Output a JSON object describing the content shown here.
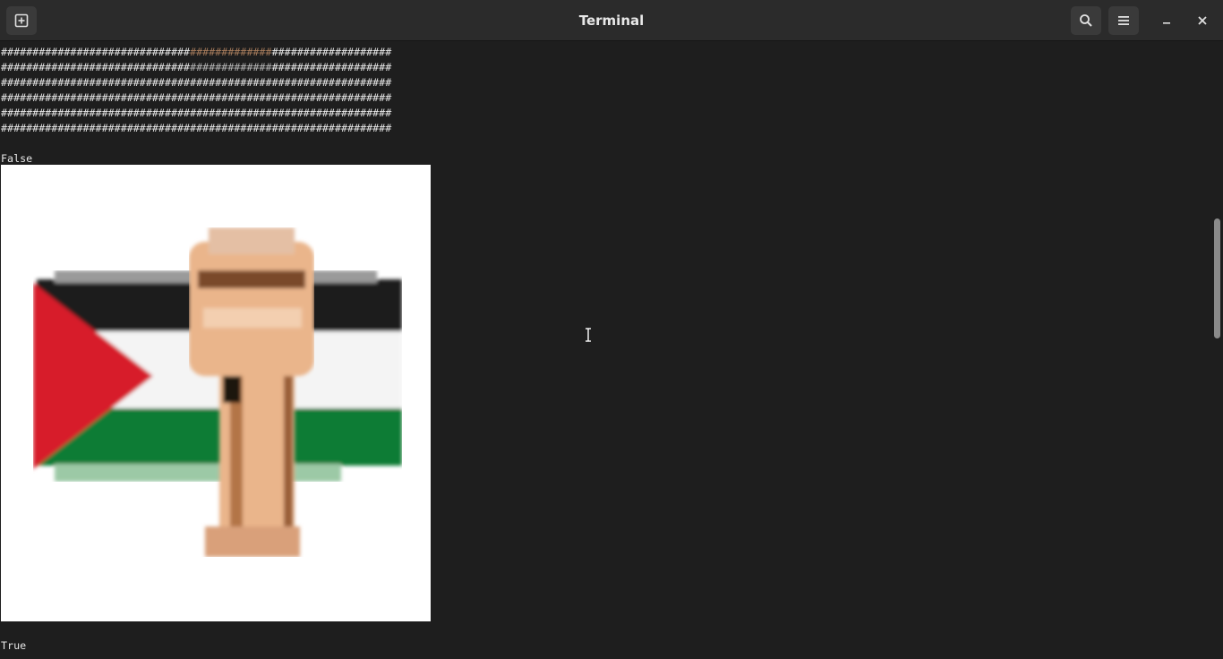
{
  "window": {
    "title": "Terminal"
  },
  "headerbar": {
    "new_tab_icon": "new-tab-icon",
    "search_icon": "search-icon",
    "menu_icon": "hamburger-menu-icon",
    "minimize_icon": "minimize-icon",
    "close_icon": "close-icon"
  },
  "terminal": {
    "hash_rows": [
      {
        "a": "##############################",
        "b": "#############",
        "c": "###################"
      },
      {
        "a": "##############################",
        "b": "#############",
        "c": "###################"
      },
      {
        "a": "##############################",
        "b": "#############",
        "c": "###################"
      },
      {
        "a": "##############################",
        "b": "#############",
        "c": "###################"
      },
      {
        "a": "##############################",
        "b": "#############",
        "c": "###################"
      },
      {
        "a": "##############################",
        "b": "#############",
        "c": "###################"
      }
    ],
    "output_false": "False",
    "output_true": "True",
    "image_description_icon": "palestine-flag-fist-image"
  },
  "colors": {
    "background": "#1e1e1e",
    "headerbar": "#2b2b2b",
    "text": "#e6e6e6",
    "flag_red": "#d8192a",
    "flag_black": "#151515",
    "flag_green": "#0a7a35",
    "skin": "#e8b48a"
  }
}
